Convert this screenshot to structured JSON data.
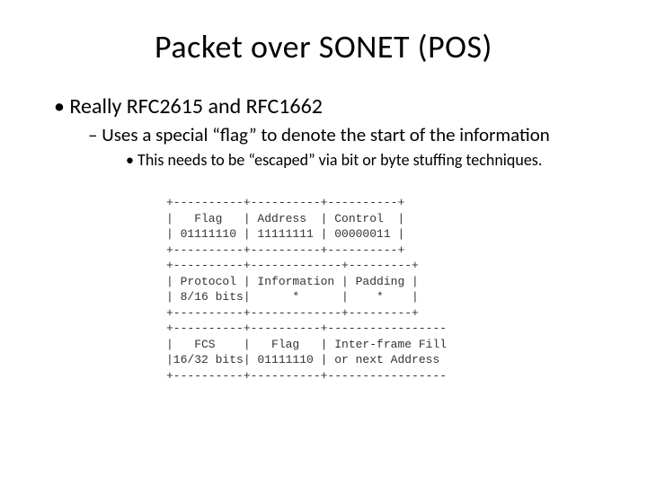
{
  "title": "Packet over SONET (POS)",
  "bullets": {
    "lvl1": "Really RFC2615 and RFC1662",
    "lvl2": "Uses a special “flag” to denote the start of the information",
    "lvl3": "This needs to be “escaped” via bit or byte stuffing techniques."
  },
  "diagram": {
    "l01": "+----------+----------+----------+",
    "l02": "|   Flag   | Address  | Control  |",
    "l03": "| 01111110 | 11111111 | 00000011 |",
    "l04": "+----------+----------+----------+",
    "l05": "+----------+-------------+---------+",
    "l06": "| Protocol | Information | Padding |",
    "l07": "| 8/16 bits|      *      |    *    |",
    "l08": "+----------+-------------+---------+",
    "l09": "+----------+----------+-----------------",
    "l10": "|   FCS    |   Flag   | Inter-frame Fill",
    "l11": "|16/32 bits| 01111110 | or next Address",
    "l12": "+----------+----------+-----------------"
  }
}
